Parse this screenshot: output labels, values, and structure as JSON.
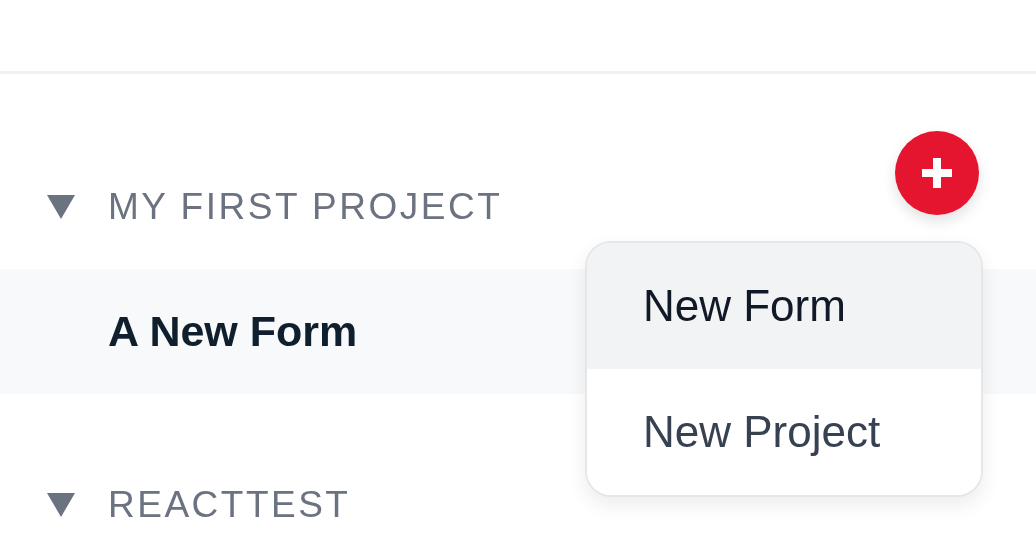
{
  "projects": [
    {
      "name": "MY FIRST PROJECT",
      "expanded": true,
      "items": [
        {
          "label": "A New Form",
          "selected": true
        }
      ]
    },
    {
      "name": "REACTTEST",
      "expanded": true
    }
  ],
  "add_menu": {
    "items": [
      {
        "label": "New Form",
        "selected": true
      },
      {
        "label": "New Project",
        "selected": false
      }
    ]
  }
}
